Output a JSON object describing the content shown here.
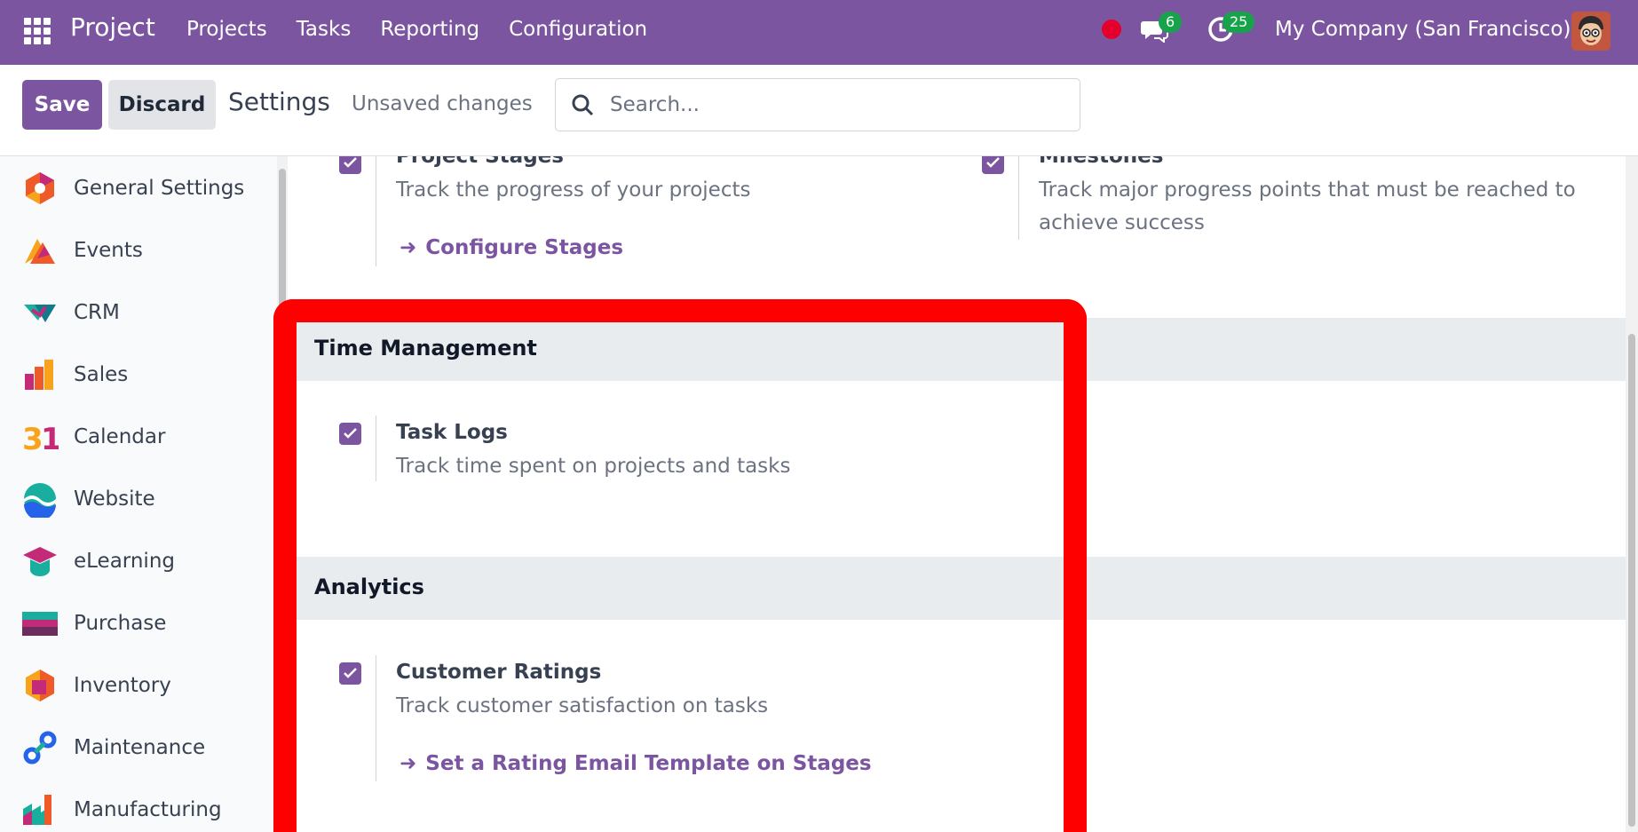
{
  "navbar": {
    "brand": "Project",
    "menu": [
      "Projects",
      "Tasks",
      "Reporting",
      "Configuration"
    ],
    "messages_count": "6",
    "activities_count": "25",
    "company": "My Company (San Francisco)"
  },
  "control": {
    "save_label": "Save",
    "discard_label": "Discard",
    "title": "Settings",
    "status": "Unsaved changes",
    "search_placeholder": "Search..."
  },
  "sidebar": {
    "items": [
      {
        "label": "General Settings",
        "icon": "general-settings-icon"
      },
      {
        "label": "Events",
        "icon": "events-icon"
      },
      {
        "label": "CRM",
        "icon": "crm-icon"
      },
      {
        "label": "Sales",
        "icon": "sales-icon"
      },
      {
        "label": "Calendar",
        "icon": "calendar-icon"
      },
      {
        "label": "Website",
        "icon": "website-icon"
      },
      {
        "label": "eLearning",
        "icon": "elearning-icon"
      },
      {
        "label": "Purchase",
        "icon": "purchase-icon"
      },
      {
        "label": "Inventory",
        "icon": "inventory-icon"
      },
      {
        "label": "Maintenance",
        "icon": "maintenance-icon"
      },
      {
        "label": "Manufacturing",
        "icon": "manufacturing-icon"
      }
    ]
  },
  "settings": {
    "project_stages": {
      "title": "Project Stages",
      "desc": "Track the progress of your projects",
      "link": "Configure Stages",
      "checked": true
    },
    "milestones": {
      "title": "Milestones",
      "desc": "Track major progress points that must be reached to achieve success",
      "checked": true
    },
    "time_management": {
      "section": "Time Management",
      "task_logs_title": "Task Logs",
      "task_logs_desc": "Track time spent on projects and tasks",
      "checked": true
    },
    "analytics": {
      "section": "Analytics",
      "ratings_title": "Customer Ratings",
      "ratings_desc": "Track customer satisfaction on tasks",
      "ratings_link": "Set a Rating Email Template on Stages",
      "checked": true
    }
  },
  "colors": {
    "brand": "#7c55a0",
    "highlight": "#ff0000",
    "badge": "#17a34a"
  }
}
